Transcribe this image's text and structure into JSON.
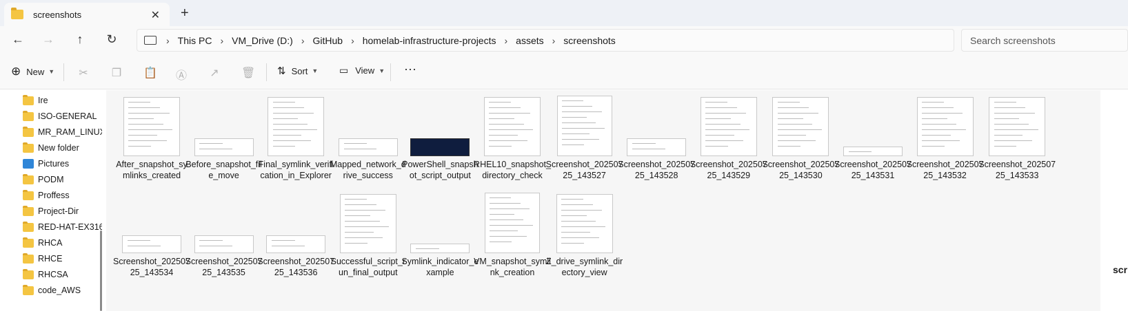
{
  "window": {
    "tab_title": "screenshots"
  },
  "address": {
    "crumbs": [
      "This PC",
      "VM_Drive (D:)",
      "GitHub",
      "homelab-infrastructure-projects",
      "assets",
      "screenshots"
    ],
    "search_placeholder": "Search screenshots"
  },
  "toolbar": {
    "new_label": "New",
    "sort_label": "Sort",
    "view_label": "View",
    "more_label": "···"
  },
  "sidebar": {
    "items": [
      {
        "label": "Ire",
        "icon": "folder"
      },
      {
        "label": "ISO-GENERAL",
        "icon": "folder"
      },
      {
        "label": "MR_RAM_LINUX",
        "icon": "folder"
      },
      {
        "label": "New folder",
        "icon": "folder"
      },
      {
        "label": "Pictures",
        "icon": "pictures"
      },
      {
        "label": "PODM",
        "icon": "folder"
      },
      {
        "label": "Proffess",
        "icon": "folder"
      },
      {
        "label": "Project-Dir",
        "icon": "folder"
      },
      {
        "label": "RED-HAT-EX316",
        "icon": "folder"
      },
      {
        "label": "RHCA",
        "icon": "folder"
      },
      {
        "label": "RHCE",
        "icon": "folder"
      },
      {
        "label": "RHCSA",
        "icon": "folder"
      },
      {
        "label": "code_AWS",
        "icon": "folder"
      }
    ]
  },
  "files": [
    {
      "name": "After_snapshot_symlinks_created",
      "thumb": "dialog"
    },
    {
      "name": "Before_snapshot_file_move",
      "thumb": "wide"
    },
    {
      "name": "Final_symlink_verification_in_Explorer",
      "thumb": "dialog"
    },
    {
      "name": "Mapped_network_drive_success",
      "thumb": "wide"
    },
    {
      "name": "PowerShell_snapshot_script_output",
      "thumb": "dark"
    },
    {
      "name": "RHEL10_snapshot_directory_check",
      "thumb": "dialog"
    },
    {
      "name": "Screenshot_20250725_143527",
      "thumb": "tall"
    },
    {
      "name": "Screenshot_20250725_143528",
      "thumb": "wide"
    },
    {
      "name": "Screenshot_20250725_143529",
      "thumb": "dialog"
    },
    {
      "name": "Screenshot_20250725_143530",
      "thumb": "dialog"
    },
    {
      "name": "Screenshot_20250725_143531",
      "thumb": "thin"
    },
    {
      "name": "Screenshot_20250725_143532",
      "thumb": "dialog"
    },
    {
      "name": "Screenshot_20250725_143533",
      "thumb": "dialog"
    },
    {
      "name": "Screenshot_20250725_143534",
      "thumb": "wide"
    },
    {
      "name": "Screenshot_20250725_143535",
      "thumb": "wide"
    },
    {
      "name": "Screenshot_20250725_143536",
      "thumb": "wide"
    },
    {
      "name": "Successful_script_run_final_output",
      "thumb": "dialog"
    },
    {
      "name": "Symlink_indicator_example",
      "thumb": "thin"
    },
    {
      "name": "VM_snapshot_symlink_creation",
      "thumb": "tall"
    },
    {
      "name": "Z_drive_symlink_directory_view",
      "thumb": "dialog"
    }
  ],
  "details_pane": {
    "label": "scr"
  },
  "colors": {
    "folder": "#f4c542",
    "accent": "#2f86d8"
  }
}
